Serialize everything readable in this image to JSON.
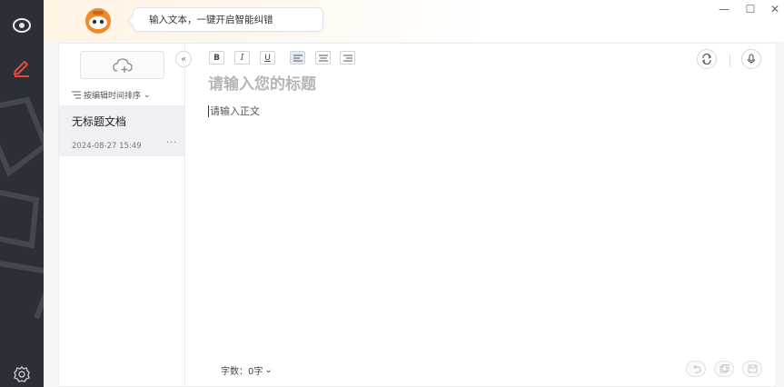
{
  "topbar": {
    "bubble_text": "输入文本，一键开启智能纠错",
    "minimize_label": "—",
    "maximize_label": "☐",
    "close_label": "✕"
  },
  "sidebar": {
    "collapse_label": "«",
    "sort_label": "按编辑时间排序",
    "sort_arrow": "⌄",
    "documents": [
      {
        "title": "无标题文档",
        "time": "2024-08-27 15:49",
        "more": "···"
      }
    ]
  },
  "toolbar": {
    "bold": "B",
    "italic": "I",
    "underline": "U"
  },
  "editor": {
    "title_placeholder": "请输入您的标题",
    "body_placeholder": "请输入正文"
  },
  "footer": {
    "word_count_label": "字数：0字",
    "word_count_arrow": "⌄"
  },
  "colors": {
    "rail": "#2c2f36",
    "accent": "#e8473d",
    "mascot": "#f08a2b"
  }
}
